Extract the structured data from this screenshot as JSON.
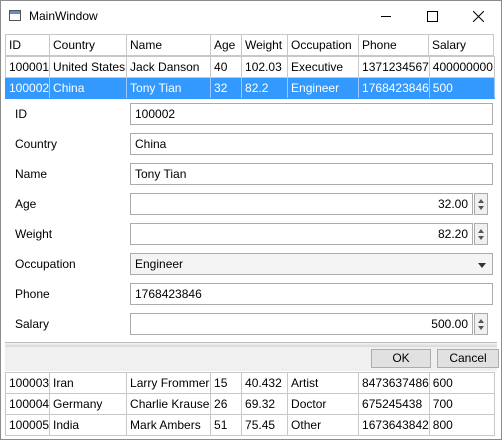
{
  "window": {
    "title": "MainWindow"
  },
  "columns": [
    "ID",
    "Country",
    "Name",
    "Age",
    "Weight",
    "Occupation",
    "Phone",
    "Salary"
  ],
  "rows_top": [
    [
      "100001",
      "United States",
      "Jack Danson",
      "40",
      "102.03",
      "Executive",
      "1371234567",
      "400000000"
    ],
    [
      "100002",
      "China",
      "Tony Tian",
      "32",
      "82.2",
      "Engineer",
      "1768423846",
      "500"
    ]
  ],
  "rows_bottom": [
    [
      "100003",
      "Iran",
      "Larry Frommer",
      "15",
      "40.432",
      "Artist",
      "8473637486",
      "600"
    ],
    [
      "100004",
      "Germany",
      "Charlie Krause",
      "26",
      "69.32",
      "Doctor",
      "675245438",
      "700"
    ],
    [
      "100005",
      "India",
      "Mark Ambers",
      "51",
      "75.45",
      "Other",
      "1673643842",
      "800"
    ]
  ],
  "details": {
    "id": {
      "label": "ID",
      "value": "100002"
    },
    "country": {
      "label": "Country",
      "value": "China"
    },
    "name": {
      "label": "Name",
      "value": "Tony Tian"
    },
    "age": {
      "label": "Age",
      "value": "32.00"
    },
    "weight": {
      "label": "Weight",
      "value": "82.20"
    },
    "occupation": {
      "label": "Occupation",
      "value": "Engineer"
    },
    "phone": {
      "label": "Phone",
      "value": "1768423846"
    },
    "salary": {
      "label": "Salary",
      "value": "500.00"
    }
  },
  "buttons": {
    "ok": "OK",
    "cancel": "Cancel"
  },
  "colors": {
    "selection": "#3399ff"
  }
}
